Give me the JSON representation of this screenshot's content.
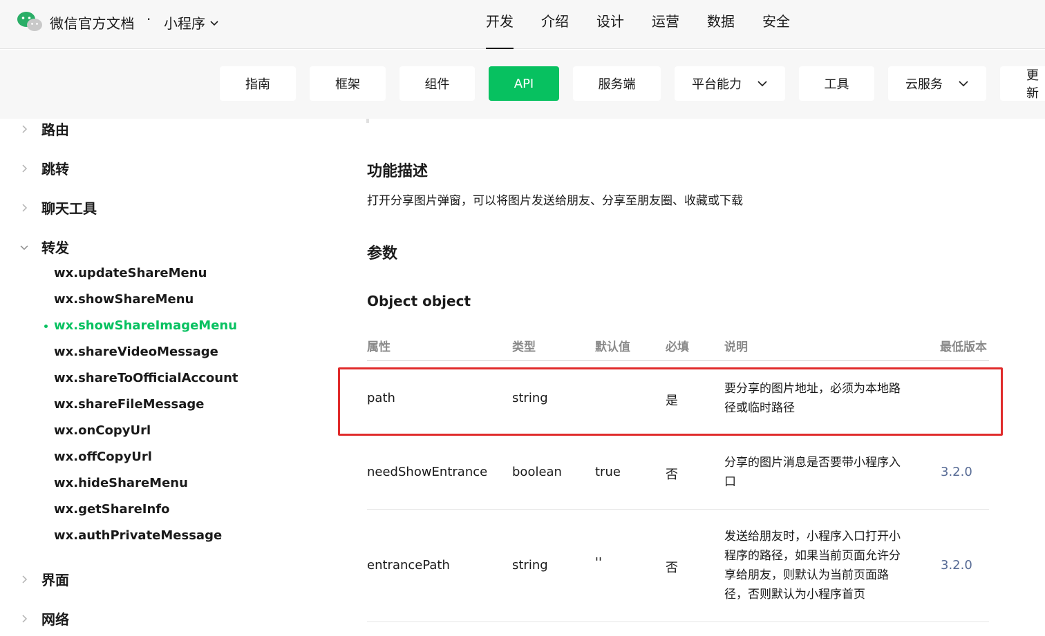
{
  "header": {
    "brand_title": "微信官方文档",
    "separator": "·",
    "product_switch": "小程序",
    "nav": [
      "开发",
      "介绍",
      "设计",
      "运营",
      "数据",
      "安全"
    ],
    "active_nav": "开发"
  },
  "subnav": {
    "tabs": [
      "指南",
      "框架",
      "组件",
      "API",
      "服务端",
      "平台能力",
      "工具",
      "云服务",
      "更新"
    ],
    "active_tab": "API",
    "accent_color": "#07c160"
  },
  "sidebar": {
    "groups_top": [
      "路由",
      "跳转",
      "聊天工具"
    ],
    "open_group": "转发",
    "items": [
      "wx.updateShareMenu",
      "wx.showShareMenu",
      "wx.showShareImageMenu",
      "wx.shareVideoMessage",
      "wx.shareToOfficialAccount",
      "wx.shareFileMessage",
      "wx.onCopyUrl",
      "wx.offCopyUrl",
      "wx.hideShareMenu",
      "wx.getShareInfo",
      "wx.authPrivateMessage"
    ],
    "active_item": "wx.showShareImageMenu",
    "groups_bottom": [
      "界面",
      "网络"
    ]
  },
  "main": {
    "section_function": "功能描述",
    "function_desc": "打开分享图片弹窗，可以将图片发送给朋友、分享至朋友圈、收藏或下载",
    "section_params": "参数",
    "object_title": "Object object",
    "table_headers": [
      "属性",
      "类型",
      "默认值",
      "必填",
      "说明",
      "最低版本"
    ],
    "rows": [
      {
        "name": "path",
        "type": "string",
        "default": "",
        "required": "是",
        "desc": "要分享的图片地址，必须为本地路径或临时路径",
        "version": ""
      },
      {
        "name": "needShowEntrance",
        "type": "boolean",
        "default": "true",
        "required": "否",
        "desc": "分享的图片消息是否要带小程序入口",
        "version": "3.2.0"
      },
      {
        "name": "entrancePath",
        "type": "string",
        "default": "''",
        "required": "否",
        "desc": "发送给朋友时，小程序入口打开小程序的路径，如果当前页面允许分享给朋友，则默认为当前页面路径，否则默认为小程序首页",
        "version": "3.2.0"
      }
    ],
    "link_color": "#576b95",
    "highlight_color": "#e02b2b"
  }
}
